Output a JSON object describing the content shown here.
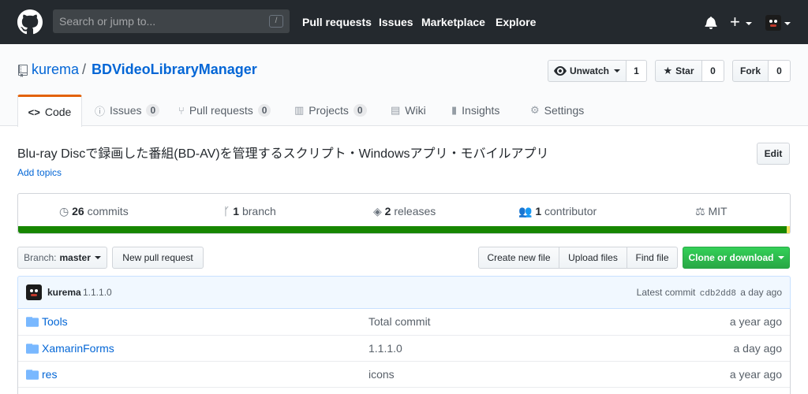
{
  "header": {
    "search_placeholder": "Search or jump to...",
    "slash_key": "/",
    "nav": [
      "Pull requests",
      "Issues",
      "Marketplace",
      "Explore"
    ]
  },
  "repo": {
    "owner": "kurema",
    "separator": "/",
    "name": "BDVideoLibraryManager"
  },
  "actions": {
    "unwatch": "Unwatch",
    "unwatch_count": "1",
    "star": "Star",
    "star_count": "0",
    "fork": "Fork",
    "fork_count": "0"
  },
  "tabs": [
    {
      "label": "Code"
    },
    {
      "label": "Issues",
      "count": "0"
    },
    {
      "label": "Pull requests",
      "count": "0"
    },
    {
      "label": "Projects",
      "count": "0"
    },
    {
      "label": "Wiki"
    },
    {
      "label": "Insights"
    },
    {
      "label": "Settings"
    }
  ],
  "description": "Blu-ray Discで録画した番組(BD-AV)を管理するスクリプト・Windowsアプリ・モバイルアプリ",
  "edit_label": "Edit",
  "add_topics": "Add topics",
  "summary": {
    "commits_num": "26",
    "commits_label": "commits",
    "branch_num": "1",
    "branch_label": "branch",
    "releases_num": "2",
    "releases_label": "releases",
    "contributors_num": "1",
    "contributors_label": "contributor",
    "license": "MIT"
  },
  "language_colors": {
    "primary": "#178600",
    "secondary": "#f1e05a"
  },
  "file_nav": {
    "branch_prefix": "Branch:",
    "branch": "master",
    "new_pr": "New pull request",
    "create_file": "Create new file",
    "upload_files": "Upload files",
    "find_file": "Find file",
    "clone": "Clone or download"
  },
  "latest_commit": {
    "author": "kurema",
    "message": "1.1.1.0",
    "label": "Latest commit",
    "sha": "cdb2dd8",
    "age": "a day ago"
  },
  "files": [
    {
      "name": "Tools",
      "message": "Total commit",
      "age": "a year ago"
    },
    {
      "name": "XamarinForms",
      "message": "1.1.1.0",
      "age": "a day ago"
    },
    {
      "name": "res",
      "message": "icons",
      "age": "a year ago"
    }
  ]
}
